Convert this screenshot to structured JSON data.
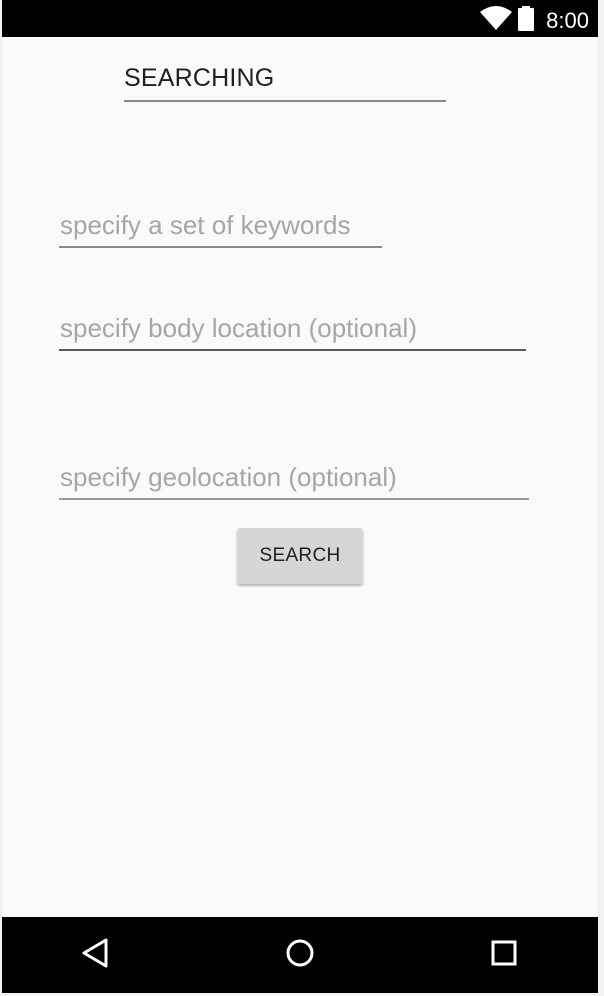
{
  "status_bar": {
    "time": "8:00",
    "icons": [
      "wifi-icon",
      "battery-icon"
    ]
  },
  "screen": {
    "title": "SEARCHING",
    "fields": [
      {
        "placeholder": "specify a set of keywords",
        "value": ""
      },
      {
        "placeholder": "specify body location (optional)",
        "value": ""
      },
      {
        "placeholder": "specify geolocation (optional)",
        "value": ""
      }
    ],
    "search_button_label": "SEARCH"
  },
  "nav_bar": {
    "icons": [
      "back-icon",
      "home-icon",
      "recents-icon"
    ]
  },
  "colors": {
    "background": "#fafafa",
    "bars": "#000000",
    "button": "#d6d6d6",
    "placeholder_text": "#a6a6a6"
  }
}
